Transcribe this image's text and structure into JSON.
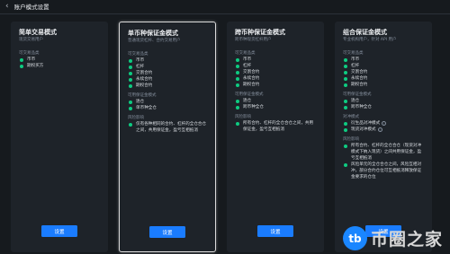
{
  "header": {
    "back_icon": "chevron-left-icon",
    "title": "账户模式设置"
  },
  "cards": [
    {
      "title": "简单交易模式",
      "subtitle": "现货交易用户",
      "sections": [
        {
          "label": "可交易品类",
          "items": [
            "币币",
            "期权买方"
          ]
        }
      ],
      "button": "设置",
      "selected": false
    },
    {
      "title": "单币种保证金模式",
      "subtitle": "普通现货杠杆、合约交易用户",
      "sections": [
        {
          "label": "可交易品类",
          "items": [
            "币币",
            "杠杆",
            "交割合约",
            "永续合约",
            "期权合约"
          ]
        },
        {
          "label": "可用保证金模式",
          "items": [
            "逐仓",
            "单币种全仓"
          ]
        },
        {
          "label": "风险影响",
          "items": [
            "仅有各种相同的合约、杠杆的全仓合仓之间，共用保证金，盈亏互相抵消"
          ]
        }
      ],
      "button": "设置",
      "selected": true
    },
    {
      "title": "跨币种保证金模式",
      "subtitle": "跨币种现货杠杆用户",
      "sections": [
        {
          "label": "可交易品类",
          "items": [
            "币币",
            "杠杆",
            "交割合约",
            "永续合约",
            "期权合约"
          ]
        },
        {
          "label": "可用保证金模式",
          "items": [
            "逐仓",
            "跨币种全仓"
          ]
        },
        {
          "label": "风险影响",
          "items": [
            "所有合约、杠杆的全仓合仓之间，共用保证金，盈亏互相抵消"
          ]
        }
      ],
      "button": "设置",
      "selected": false
    },
    {
      "title": "组合保证金模式",
      "subtitle": "专业机构用户，针对 API 用户",
      "sections": [
        {
          "label": "可交易品类",
          "items": [
            "币币",
            "杠杆",
            "交割合约",
            "永续合约",
            "期权合约"
          ]
        },
        {
          "label": "可用保证金模式",
          "items": [
            "逐仓",
            "跨币种全仓"
          ]
        },
        {
          "label": "对冲模式",
          "items": [
            "衍生品对冲模式",
            "现货对冲模式"
          ]
        },
        {
          "label": "风险影响",
          "items": [
            "所有合约、杠杆的全仓合仓（现货对冲模式下纳入现货）之间共用保证金，盈亏互相抵消",
            "风险单元的全仓合仓之间，风险互相对冲，部分合约仓位可互相抵消释放保证金要求的仓位"
          ]
        }
      ],
      "button": "设置",
      "selected": false
    }
  ],
  "watermark": {
    "logo_text": "tb",
    "text": "币圈之家"
  },
  "colors": {
    "accent": "#1a7cff",
    "dot": "#0ecb81",
    "background": "#161a1e",
    "card": "#1e2329"
  }
}
